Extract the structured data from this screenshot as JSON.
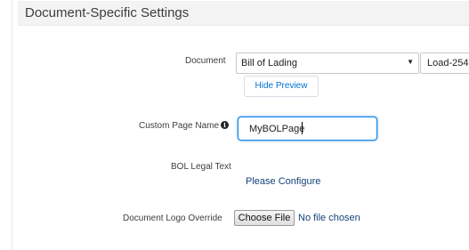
{
  "section": {
    "title": "Document-Specific Settings"
  },
  "document": {
    "label": "Document",
    "selected": "Bill of Lading",
    "secondary_selected": "Load-254",
    "preview_button_label": "Hide Preview"
  },
  "custom_page_name": {
    "label": "Custom Page Name",
    "value": "MyBOLPage",
    "info_glyph": "i"
  },
  "bol_legal_text": {
    "label": "BOL Legal Text",
    "link_label": "Please Configure"
  },
  "logo_override": {
    "label": "Document Logo Override",
    "button_label": "Choose File",
    "status": "No file chosen"
  },
  "icons": {
    "select_arrow": "▼",
    "info": "info-icon"
  },
  "colors": {
    "link": "#15427a",
    "button_text": "#0070d2",
    "focus_border": "#1589ee",
    "header_bg": "#f3f3f3"
  }
}
